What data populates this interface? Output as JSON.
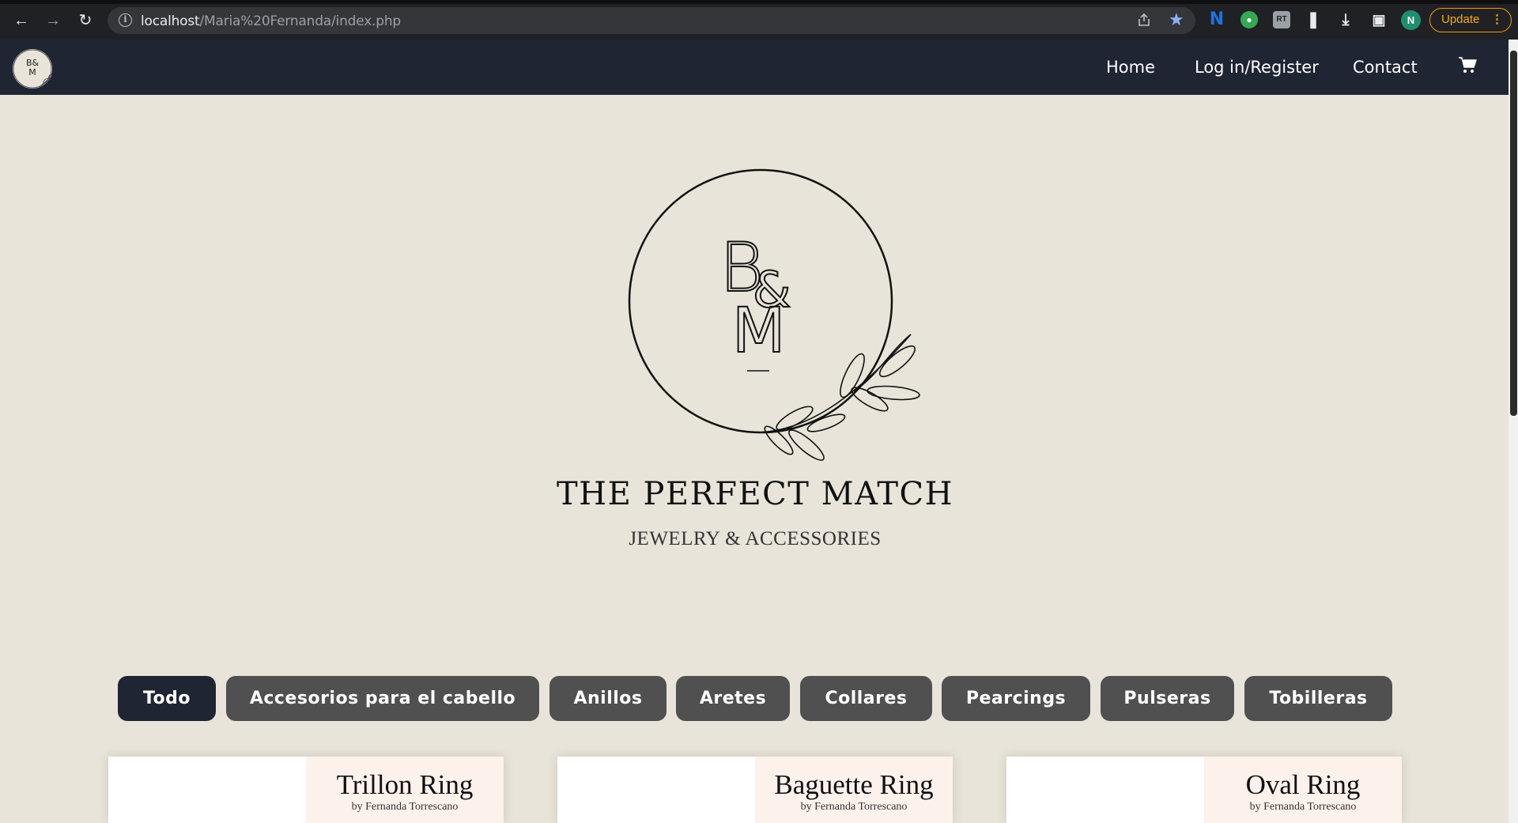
{
  "browser": {
    "url_host": "localhost",
    "url_path": "/Maria%20Fernanda/index.php",
    "update_label": "Update",
    "profile_initial": "N",
    "ext_rt_label": "RT",
    "ext_n_label": "N"
  },
  "nav": {
    "logo_text": "B&M",
    "links": [
      "Home",
      "Log in/Register",
      "Contact"
    ]
  },
  "hero": {
    "logo_text": "B&M",
    "title": "THE PERFECT MATCH",
    "subtitle": "JEWELRY & ACCESSORIES"
  },
  "filters": {
    "active_index": 0,
    "items": [
      "Todo",
      "Accesorios para el cabello",
      "Anillos",
      "Aretes",
      "Collares",
      "Pearcings",
      "Pulseras",
      "Tobilleras"
    ]
  },
  "products": [
    {
      "name": "Trillon Ring",
      "by": "by Fernanda Torrescano"
    },
    {
      "name": "Baguette Ring",
      "by": "by Fernanda Torrescano"
    },
    {
      "name": "Oval Ring",
      "by": "by Fernanda Torrescano"
    }
  ],
  "colors": {
    "page_bg": "#e8e4d9",
    "nav_bg": "#1f2533",
    "pill_bg": "#505050",
    "pill_active_bg": "#1f2533",
    "card_accent": "#fdf1ec"
  },
  "icons": [
    "back-icon",
    "forward-icon",
    "reload-icon",
    "info-icon",
    "share-icon",
    "star-icon",
    "puzzle-icon",
    "download-icon",
    "side-panel-icon",
    "cart-icon",
    "leaf-icon"
  ]
}
